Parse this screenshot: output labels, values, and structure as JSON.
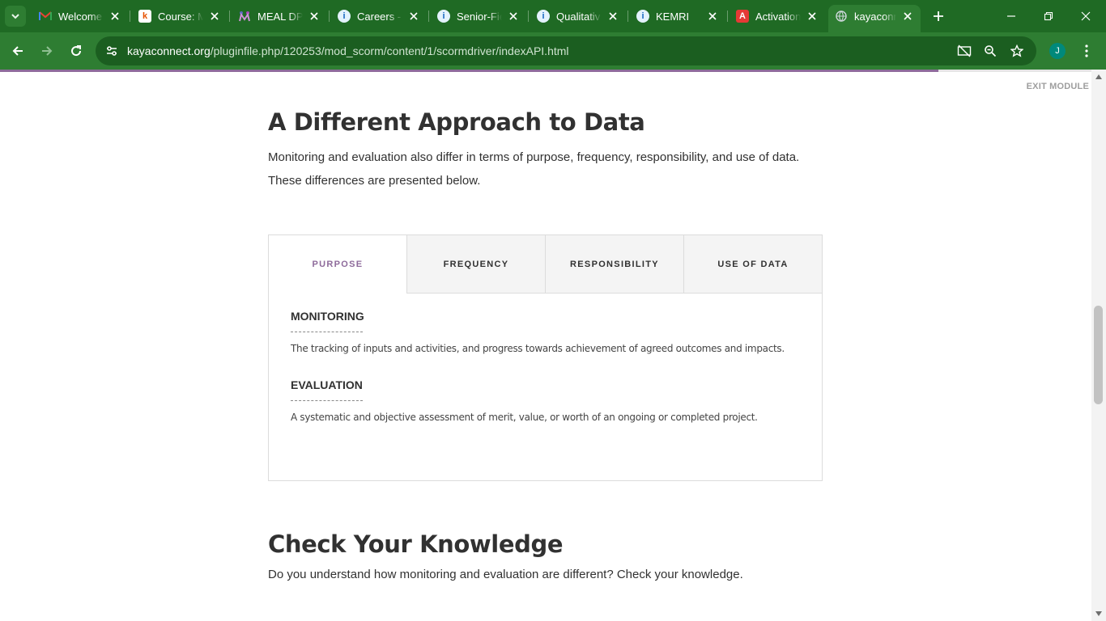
{
  "browser": {
    "tabs": [
      {
        "title": "Welcome",
        "icon": "gmail-icon"
      },
      {
        "title": "Course: M",
        "icon": "kaya-icon"
      },
      {
        "title": "MEAL DPro",
        "icon": "meal-dpro-icon"
      },
      {
        "title": "Careers -",
        "icon": "info-icon"
      },
      {
        "title": "Senior-Fie",
        "icon": "info-icon"
      },
      {
        "title": "Qualitativ",
        "icon": "info-icon"
      },
      {
        "title": "KEMRI",
        "icon": "info-icon"
      },
      {
        "title": "Activation",
        "icon": "adobe-icon"
      },
      {
        "title": "kayaconn",
        "icon": "globe-icon",
        "active": true
      }
    ],
    "url_domain": "kayaconnect.org",
    "url_path": "/pluginfile.php/120253/mod_scorm/content/1/scormdriver/indexAPI.html",
    "profile_initial": "J",
    "colors": {
      "frame": "#1f6a24",
      "toolbar": "#2e7d32",
      "omnibox": "#1b5e20"
    }
  },
  "page": {
    "exit_label": "EXIT MODULE",
    "progress": 0.86,
    "section_title": "A Different Approach to Data",
    "intro_line1": "Monitoring and evaluation also differ in terms of purpose, frequency, responsibility, and use of data.",
    "intro_line2": "These differences are presented below.",
    "tabs": [
      "PURPOSE",
      "FREQUENCY",
      "RESPONSIBILITY",
      "USE OF DATA"
    ],
    "selected_tab": "PURPOSE",
    "accent_color": "#8e6b9b",
    "entries": [
      {
        "term": "MONITORING",
        "definition": "The tracking of inputs and activities, and progress towards achievement of agreed outcomes and impacts."
      },
      {
        "term": "EVALUATION",
        "definition": "A systematic and objective assessment of merit, value, or worth of an ongoing or completed project."
      }
    ],
    "knowledge_title": "Check Your Knowledge",
    "knowledge_text": "Do you understand how monitoring and evaluation are different? Check your knowledge."
  }
}
